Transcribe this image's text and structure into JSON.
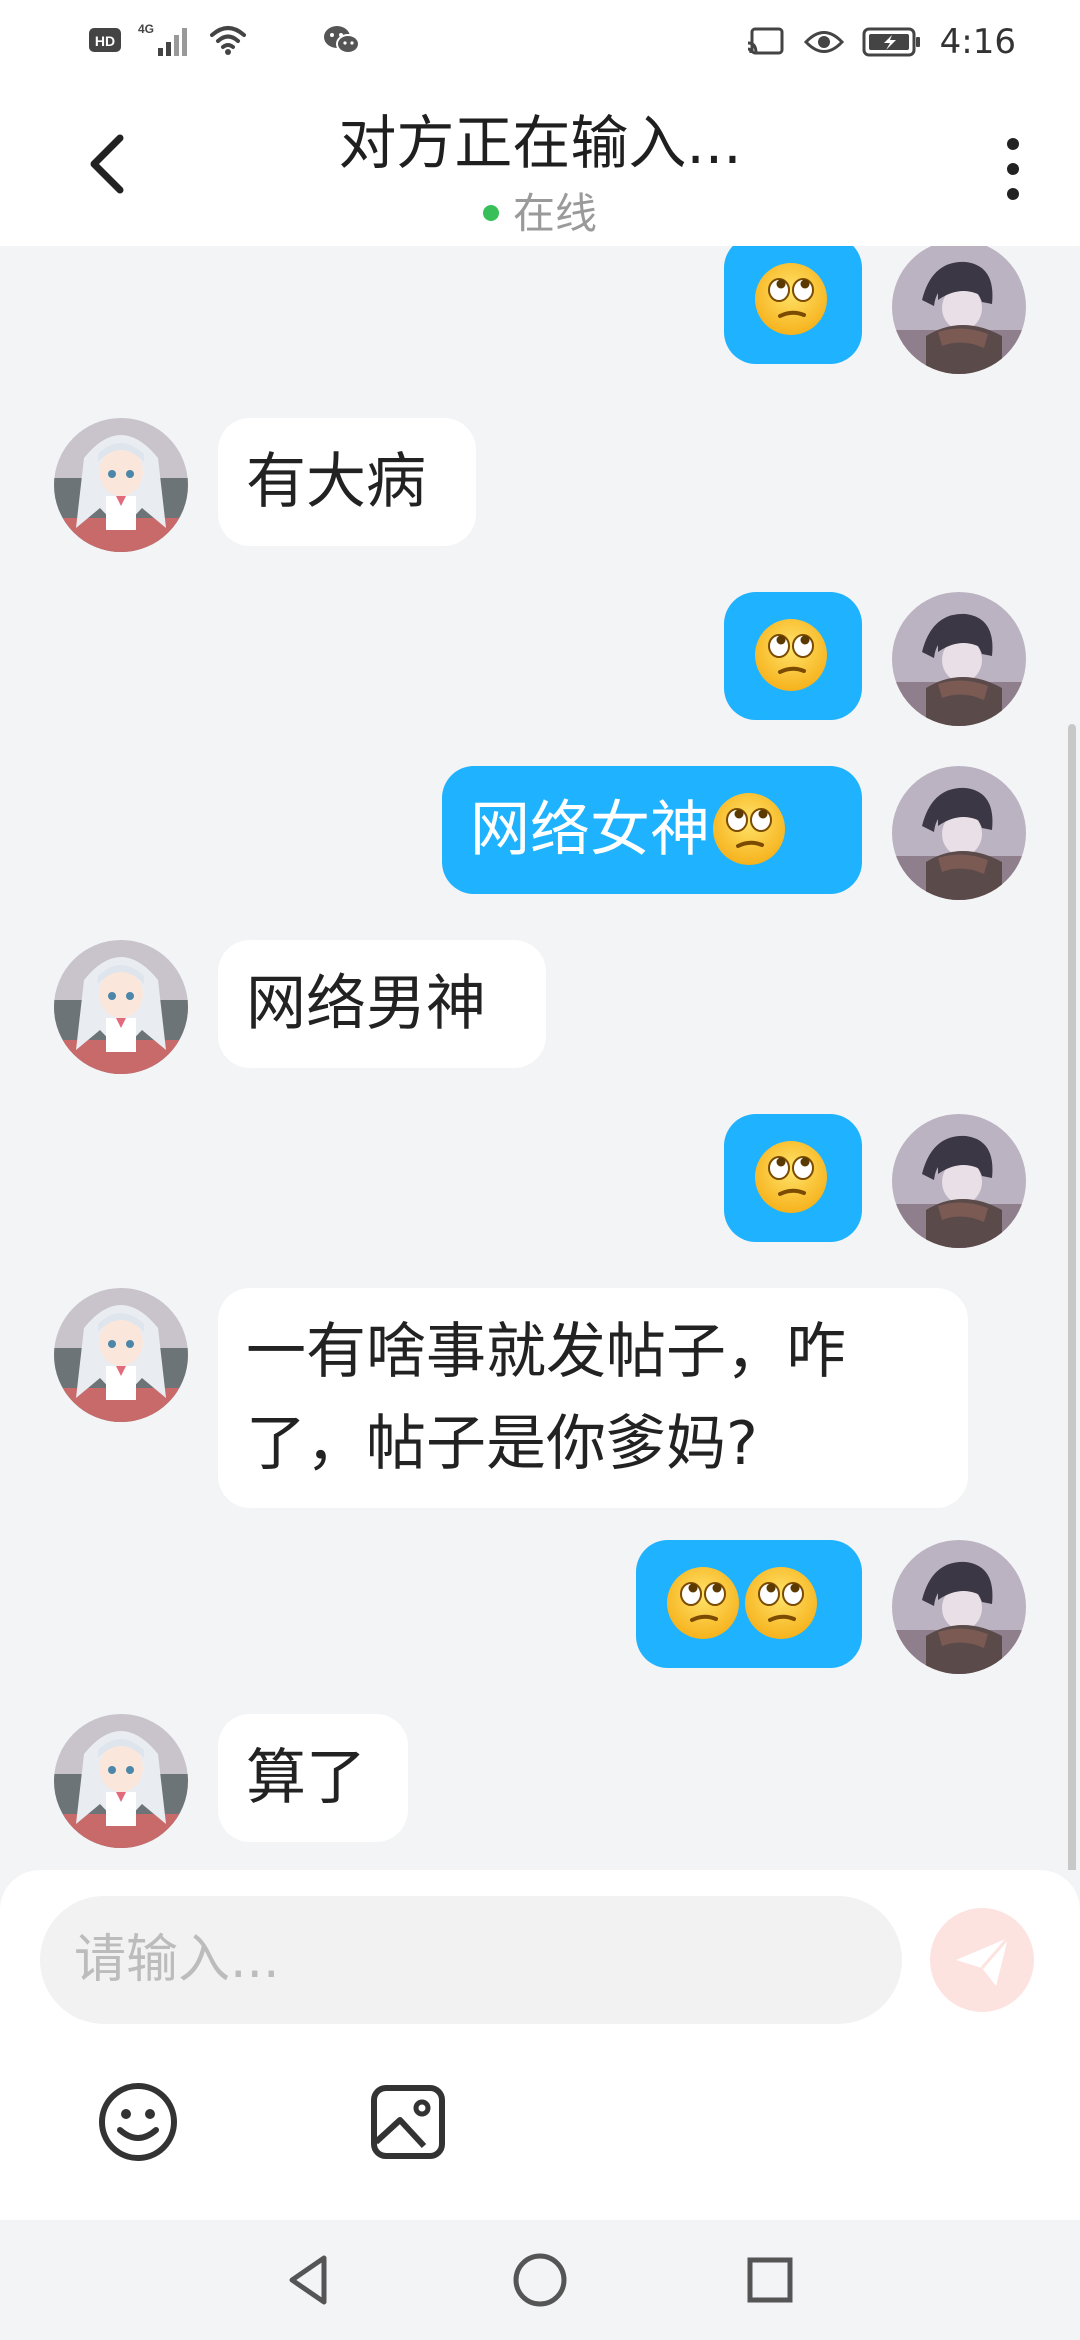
{
  "status_bar": {
    "network_badge": "HD",
    "network_type": "4G",
    "time": "4:16",
    "icons": [
      "hd-icon",
      "signal-icon",
      "wifi-icon",
      "wechat-icon",
      "cast-icon",
      "eye-icon",
      "battery-charging-icon"
    ]
  },
  "header": {
    "title": "对方正在输入...",
    "status": "在线",
    "status_color": "#37c05a"
  },
  "messages": [
    {
      "sender": "me",
      "text": "",
      "emojis": [
        "eye-roll"
      ]
    },
    {
      "sender": "other",
      "text": "有大病",
      "emojis": []
    },
    {
      "sender": "me",
      "text": "",
      "emojis": [
        "eye-roll"
      ]
    },
    {
      "sender": "me",
      "text": "网络女神",
      "emojis": [
        "eye-roll"
      ]
    },
    {
      "sender": "other",
      "text": "网络男神",
      "emojis": []
    },
    {
      "sender": "me",
      "text": "",
      "emojis": [
        "eye-roll"
      ]
    },
    {
      "sender": "other",
      "text": "一有啥事就发帖子，咋了，帖子是你爹妈?",
      "emojis": []
    },
    {
      "sender": "me",
      "text": "",
      "emojis": [
        "eye-roll",
        "eye-roll"
      ]
    },
    {
      "sender": "other",
      "text": "算了",
      "emojis": []
    }
  ],
  "composer": {
    "placeholder": "请输入...",
    "send_icon": "send-icon",
    "tools": [
      "emoji-icon",
      "image-icon"
    ]
  },
  "nav": {
    "buttons": [
      "back-triangle-icon",
      "home-circle-icon",
      "recents-square-icon"
    ]
  },
  "colors": {
    "outgoing_bubble": "#1fb2ff",
    "incoming_bubble": "#ffffff",
    "background": "#f3f4f6",
    "send_button": "#fde3e0"
  }
}
